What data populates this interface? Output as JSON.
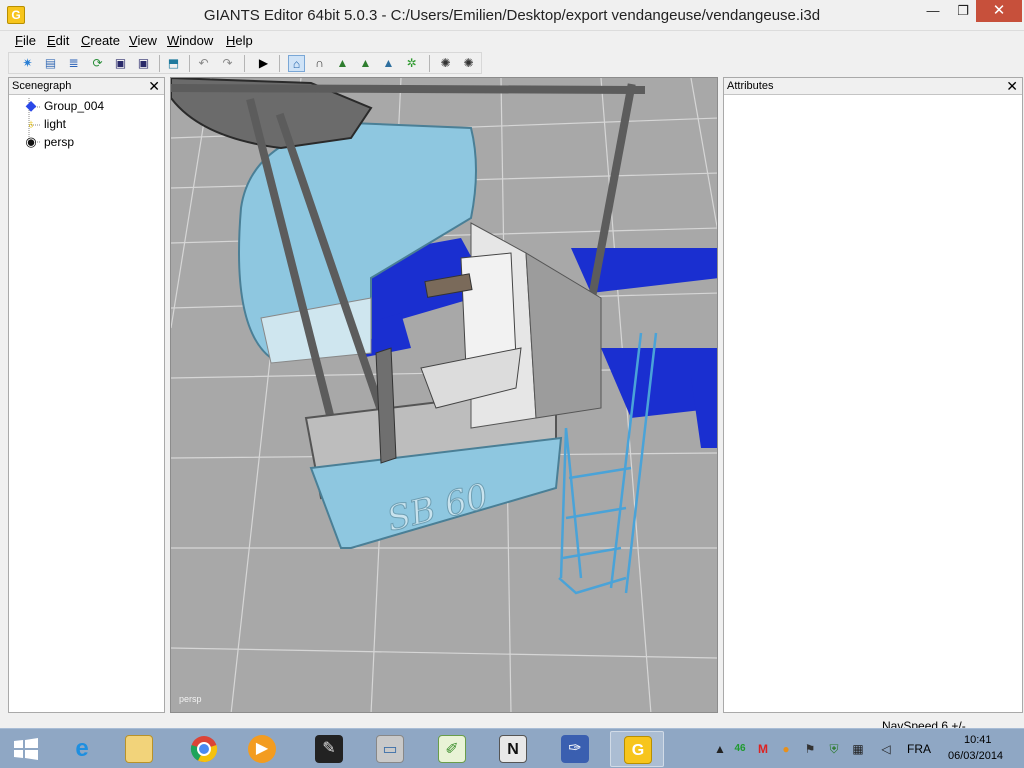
{
  "window": {
    "title": "GIANTS Editor 64bit 5.0.3 - C:/Users/Emilien/Desktop/export vendangeuse/vendangeuse.i3d",
    "app_icon": "G",
    "minimize": "—",
    "maximize": "❐",
    "close": "✕"
  },
  "menu": [
    "File",
    "Edit",
    "Create",
    "View",
    "Window",
    "Help"
  ],
  "toolbar": {
    "icons": [
      "new-scene-icon",
      "open-icon",
      "import-icon",
      "refresh-icon",
      "save-icon",
      "save-as-icon",
      "export-icon",
      "undo-icon",
      "redo-icon",
      "play-icon",
      "select-mode-icon",
      "magnet-icon",
      "terrain-sculpt-icon",
      "terrain-paint-icon",
      "terrain-texture-icon",
      "foliage-paint-icon",
      "physics-icon",
      "physics-step-icon"
    ]
  },
  "scenegraph": {
    "title": "Scenegraph",
    "close": "✕",
    "items": [
      {
        "label": "Group_004",
        "icon": "transform-group-icon"
      },
      {
        "label": "light",
        "icon": "light-bulb-icon"
      },
      {
        "label": "persp",
        "icon": "camera-icon"
      }
    ]
  },
  "attributes": {
    "title": "Attributes",
    "close": "✕"
  },
  "viewport": {
    "camera_label": "persp",
    "model_text": "SB 60"
  },
  "status": {
    "navspeed": "NavSpeed 6 +/-"
  },
  "taskbar": {
    "apps": [
      "windows-start-icon",
      "internet-explorer-icon",
      "file-explorer-icon",
      "chrome-icon",
      "media-player-icon",
      "inkscape-icon",
      "monitor-app-icon",
      "notepad-plus-plus-icon",
      "ni-mate-icon",
      "paint-app-icon",
      "giants-editor-icon"
    ],
    "tray_badge": "46",
    "language": "FRA",
    "time": "10:41",
    "date": "06/03/2014"
  },
  "colors": {
    "viewport_bg": "#a8a8a8",
    "grid_line": "#d6d6d6",
    "vehicle_body": "#8ec7e0",
    "vehicle_blue": "#1a2fd0",
    "frame_gray": "#5c5c5c",
    "taskbar": "#8fa7c4",
    "close_red": "#c7503b"
  }
}
